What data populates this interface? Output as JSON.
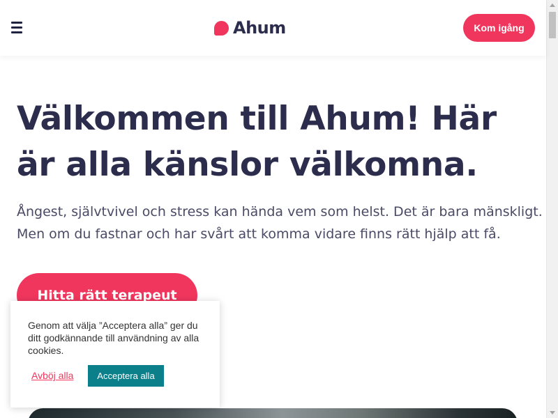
{
  "header": {
    "brand": "Ahum",
    "cta_label": "Kom igång"
  },
  "hero": {
    "title": "Välkommen till Ahum! Här är alla känslor välkomna.",
    "text": "Ångest, självtvivel och stress kan hända vem som helst. Det är bara mänskligt. Men om du fastnar och har svårt att komma vidare finns rätt hjälp att få.",
    "cta_label": "Hitta rätt terapeut"
  },
  "cookie": {
    "text": "Genom att välja ”Acceptera alla” ger du ditt godkännande till användning av alla cookies.",
    "reject_label": "Avböj alla",
    "accept_label": "Acceptera alla"
  },
  "colors": {
    "brand": "#f0365d",
    "heading": "#2c2c4d",
    "accept": "#0b7f8a"
  },
  "icons": {
    "menu": "hamburger-icon",
    "logo": "speech-bubble-logo-icon"
  }
}
